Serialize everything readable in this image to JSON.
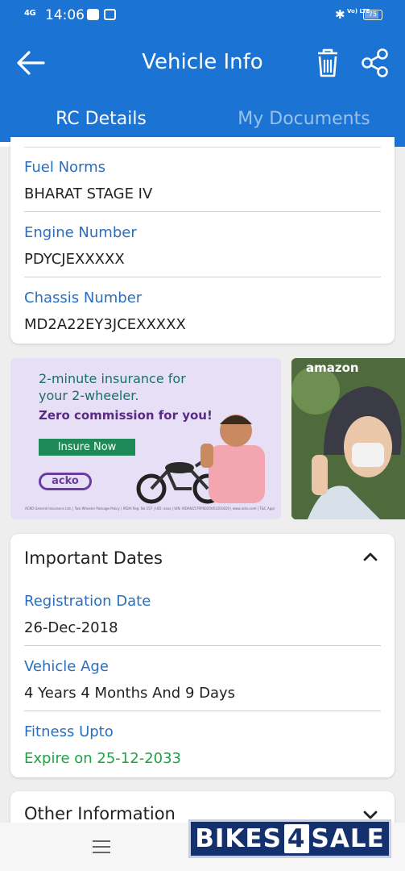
{
  "status_bar": {
    "network": "4G",
    "time": "14:06",
    "volte": "Vo) LTE",
    "battery": "75"
  },
  "header": {
    "title": "Vehicle Info",
    "icons": [
      "back-arrow-icon",
      "trash-icon",
      "share-icon"
    ]
  },
  "tabs": [
    {
      "label": "RC Details",
      "active": true
    },
    {
      "label": "My Documents",
      "active": false
    }
  ],
  "rc_details": {
    "fields": [
      {
        "label": "Fuel Norms",
        "value": "BHARAT STAGE IV"
      },
      {
        "label": "Engine Number",
        "value": "PDYCJEXXXXX"
      },
      {
        "label": "Chassis Number",
        "value": "MD2A22EY3JCEXXXXX"
      }
    ]
  },
  "ads": {
    "acko": {
      "line1": "2-minute insurance for",
      "line2": "your 2-wheeler.",
      "headline": "Zero commission for you!",
      "cta": "Insure Now",
      "logo": "acko",
      "fine_print": "ACKO General Insurance Ltd. | Two Wheeler Package Policy | IRDAI Reg. No 157 | UID: xxxx | UIN: IRDAN157RP0020V01201819 | www.acko.com | T&C Apply!"
    },
    "amazon": {
      "logo": "amazon"
    }
  },
  "important_dates": {
    "title": "Important Dates",
    "expanded": true,
    "fields": [
      {
        "label": "Registration Date",
        "value": "26-Dec-2018"
      },
      {
        "label": "Vehicle Age",
        "value": "4 Years 4 Months And 9 Days"
      },
      {
        "label": "Fitness Upto",
        "value": "Expire on 25-12-2033"
      }
    ]
  },
  "other_information": {
    "title": "Other Information",
    "expanded": false
  },
  "watermark": {
    "part1": "BIKES",
    "part2": "4",
    "part3": "SALE"
  },
  "colors": {
    "primary": "#1b74d3",
    "label": "#2a6ebd",
    "fitness_ok": "#1fa246"
  }
}
